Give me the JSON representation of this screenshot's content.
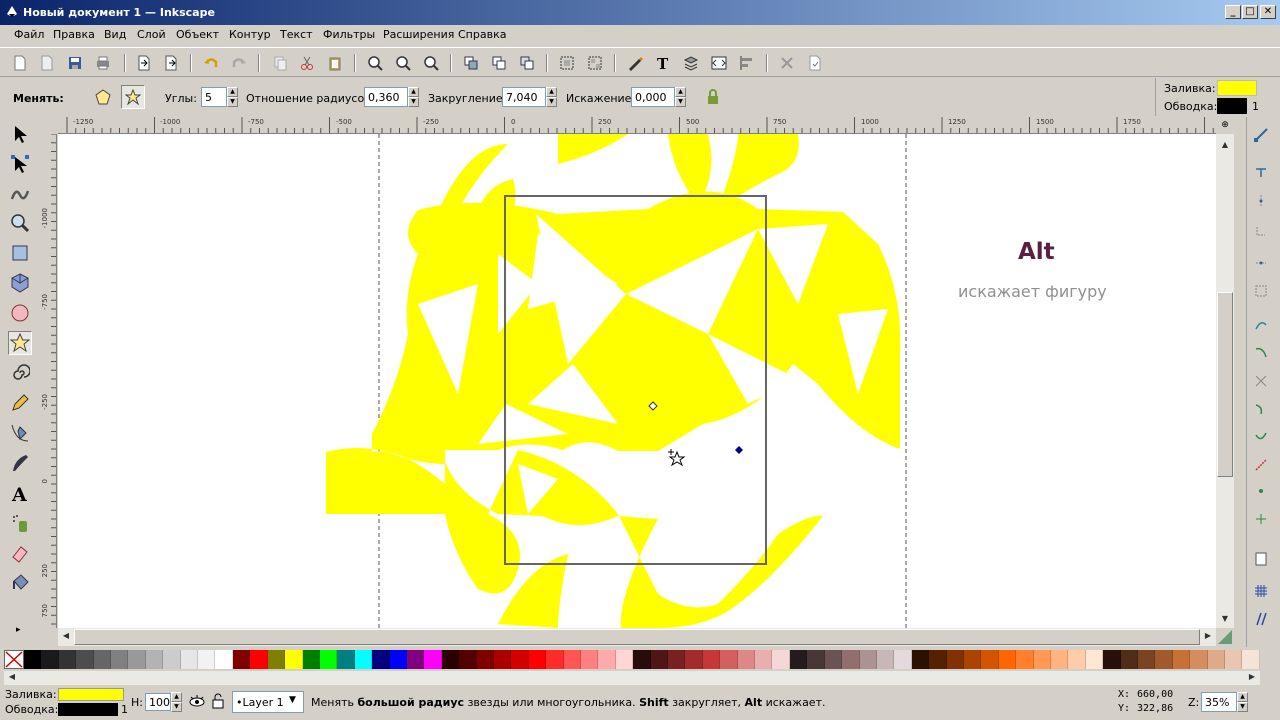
{
  "window": {
    "title": "Новый документ 1 — Inkscape",
    "buttons": {
      "minimize": "_",
      "maximize": "□",
      "close": "✕"
    }
  },
  "menu": [
    "Файл",
    "Правка",
    "Вид",
    "Слой",
    "Объект",
    "Контур",
    "Текст",
    "Фильтры",
    "Расширения",
    "Справка"
  ],
  "controls": {
    "change_label": "Менять:",
    "corners_label": "Углы:",
    "corners_value": "5",
    "ratio_label": "Отношение радиусов:",
    "ratio_value": "0,360",
    "rounding_label": "Закругление:",
    "rounding_value": "7,040",
    "randomize_label": "Искажение:",
    "randomize_value": "0,000"
  },
  "style_indicator": {
    "fill_label": "Заливка:",
    "stroke_label": "Обводка:",
    "stroke_width": "1",
    "fill_color": "#ffff00",
    "stroke_color": "#000000"
  },
  "ruler": {
    "h_labels": [
      "-1250",
      "-1000",
      "-750",
      "-500",
      "-250",
      "0",
      "250",
      "500",
      "750",
      "1000",
      "1250",
      "1500",
      "1750"
    ],
    "v_labels": [
      "-1000",
      "-750",
      "-250",
      "0",
      "250",
      "750"
    ]
  },
  "canvas": {
    "hint_key": "Alt",
    "hint_text": "искажает фигуру",
    "shape_fill": "#ffff00"
  },
  "palette": [
    "#000000",
    "#1a1a1a",
    "#333333",
    "#4d4d4d",
    "#666666",
    "#808080",
    "#999999",
    "#b3b3b3",
    "#cccccc",
    "#e6e6e6",
    "#f2f2f2",
    "#ffffff",
    "#800000",
    "#ff0000",
    "#808000",
    "#ffff00",
    "#008000",
    "#00ff00",
    "#008080",
    "#00ffff",
    "#000080",
    "#0000ff",
    "#800080",
    "#ff00ff",
    "#2b0000",
    "#550000",
    "#800000",
    "#aa0000",
    "#d40000",
    "#ff0000",
    "#ff2a2a",
    "#ff5555",
    "#ff8080",
    "#ffaaaa",
    "#ffd5d5",
    "#280b0b",
    "#501616",
    "#782121",
    "#a02c2c",
    "#c83737",
    "#d35f5f",
    "#de8787",
    "#e9afaf",
    "#f4d7d7",
    "#241c1c",
    "#483737",
    "#6c5353",
    "#916f6f",
    "#ac9393",
    "#c8b7b7",
    "#e3dbdb",
    "#2b1100",
    "#552200",
    "#803300",
    "#aa4400",
    "#d45500",
    "#ff6600",
    "#ff7f2a",
    "#ff9955",
    "#ffb380",
    "#ffccaa",
    "#ffe6d5",
    "#280f0b",
    "#502d16",
    "#784421",
    "#a05a2c",
    "#c87137",
    "#d38d5f",
    "#deaa87",
    "#e9c6af",
    "#f4e3d7"
  ],
  "status": {
    "fill_label": "Заливка:",
    "stroke_label": "Обводка:",
    "stroke_width": "1",
    "h_label": "H:",
    "opacity": "100",
    "layer": "•Layer 1",
    "msg_1": "Менять ",
    "msg_2": "большой радиус",
    "msg_3": " звезды или многоугольника. ",
    "msg_4": "Shift",
    "msg_5": " закругляет, ",
    "msg_6": "Alt",
    "msg_7": " искажает.",
    "x_label": "X:",
    "x_value": "660,00",
    "y_label": "Y:",
    "y_value": "322,86",
    "zoom_label": "Z:",
    "zoom_value": "35%"
  }
}
